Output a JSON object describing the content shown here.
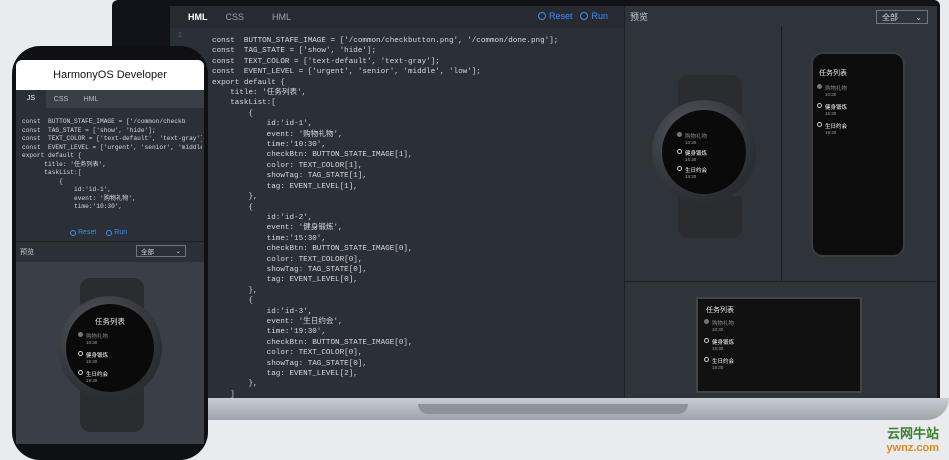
{
  "editor": {
    "tabs": [
      "HML",
      "CSS",
      "HML"
    ],
    "reset_label": "Reset",
    "run_label": "Run",
    "line_number": "1",
    "code_lines": [
      "const  BUTTON_STAFE_IMAGE = ['/common/checkbutton.png', '/common/done.png'];",
      "const  TAG_STATE = ['show', 'hide'];",
      "const  TEXT_COLOR = ['text-default', 'text-gray'];",
      "const  EVENT_LEVEL = ['urgent', 'senior', 'middle', 'low'];",
      "export default {",
      "    title: '任务列表',",
      "    taskList:[",
      "        {",
      "            id:'id-1',",
      "            event: '购物礼物',",
      "            time:'10:30',",
      "            checkBtn: BUTTON_STATE_IMAGE[1],",
      "            color: TEXT_COLOR[1],",
      "            showTag: TAG_STATE[1],",
      "            tag: EVENT_LEVEL[1],",
      "        },",
      "        {",
      "            id:'id-2',",
      "            event: '健身锻炼',",
      "            time:'15:30',",
      "            checkBtn: BUTTON_STATE_IMAGE[0],",
      "            color: TEXT_COLOR[0],",
      "            showTag: TAG_STATE[0],",
      "            tag: EVENT_LEVEL[0],",
      "        },",
      "        {",
      "            id:'id-3',",
      "            event: '生日约会',",
      "            time:'19:30',",
      "            checkBtn: BUTTON_STATE_IMAGE[0],",
      "            color: TEXT_COLOR[0],",
      "            showTag: TAG_STATE[0],",
      "            tag: EVENT_LEVEL[2],",
      "        },",
      "    ]",
      "}"
    ]
  },
  "preview": {
    "label": "预览",
    "select_value": "全部"
  },
  "watch": {
    "title": "任务列表",
    "items": [
      {
        "event": "购物礼物",
        "time": "10:30"
      },
      {
        "event": "健身锻炼",
        "time": "15:30"
      },
      {
        "event": "生日约会",
        "time": "19:30"
      }
    ]
  },
  "phone": {
    "header": "HarmonyOS Developer",
    "tabs": [
      "JS",
      "CSS",
      "HML"
    ],
    "code_lines": [
      "const  BUTTON_STAFE_IMAGE = ['/common/checkb",
      "const  TAG_STATE = ['show', 'hide'];",
      "const  TEXT_COLOR = ['text-default', 'text-gray'];",
      "const  EVENT_LEVEL = ['urgent', 'senior', 'middle',",
      "export default {",
      "      title: '任务列表',",
      "      taskList:[",
      "          {",
      "              id:'id-1',",
      "              event: '购物礼物',",
      "              time:'10:30',"
    ],
    "reset_label": "Reset",
    "run_label": "Run",
    "preview_label": "预览",
    "select_value": "全部"
  },
  "watermark": {
    "line1": "云网牛站",
    "line2": "ywnz.com"
  },
  "colors": {
    "accent": "#3d8ef8",
    "editor_bg": "#2b2f36",
    "keyword": "#d38bf2",
    "string": "#ce8c6a"
  }
}
